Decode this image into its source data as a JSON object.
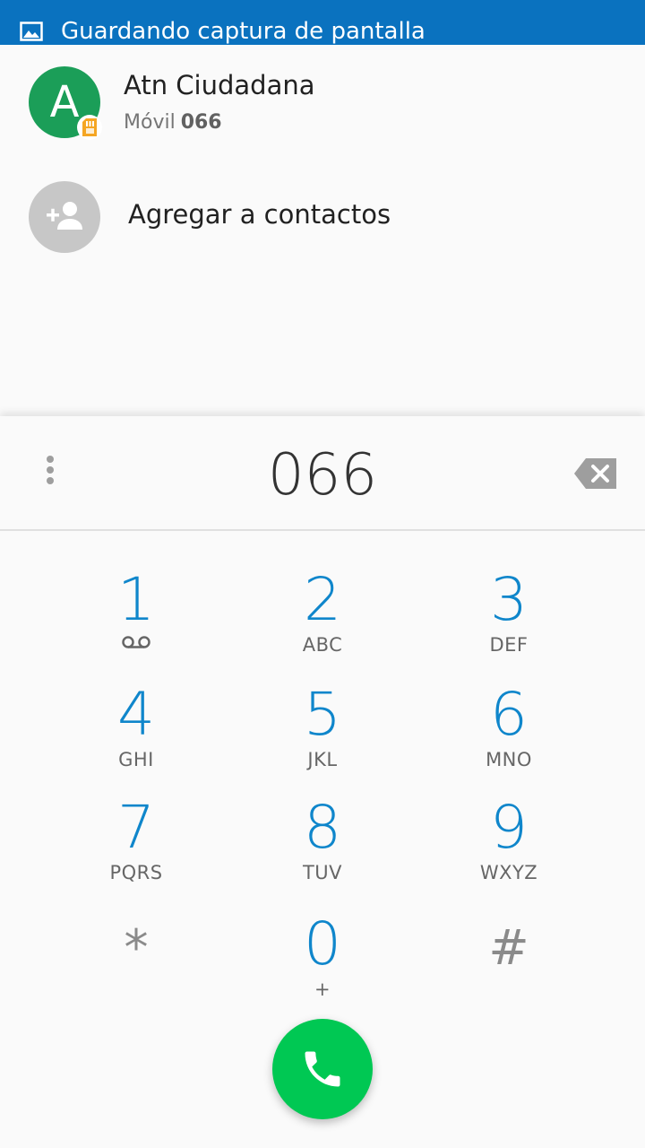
{
  "status_bar": {
    "icon": "screenshot-image-icon",
    "text": "Guardando captura de pantalla",
    "color": "#0a72bf"
  },
  "suggestions": {
    "contact": {
      "avatar_letter": "A",
      "avatar_color": "#1b9e58",
      "name": "Atn Ciudadana",
      "type_label": "Móvil",
      "number": "066",
      "badge_icon": "sim-card-icon"
    },
    "add_contact": {
      "icon": "add-person-icon",
      "label": "Agregar a contactos"
    }
  },
  "dialpad": {
    "entered_digits": "066",
    "keys": [
      {
        "digit": "1",
        "letters": "",
        "extra_icon": "voicemail-icon"
      },
      {
        "digit": "2",
        "letters": "ABC"
      },
      {
        "digit": "3",
        "letters": "DEF"
      },
      {
        "digit": "4",
        "letters": "GHI"
      },
      {
        "digit": "5",
        "letters": "JKL"
      },
      {
        "digit": "6",
        "letters": "MNO"
      },
      {
        "digit": "7",
        "letters": "PQRS"
      },
      {
        "digit": "8",
        "letters": "TUV"
      },
      {
        "digit": "9",
        "letters": "WXYZ"
      },
      {
        "digit": "*",
        "letters": ""
      },
      {
        "digit": "0",
        "letters": "+"
      },
      {
        "digit": "#",
        "letters": ""
      }
    ],
    "digit_color": "#0f86cb",
    "call_button_color": "#00c853",
    "call_icon": "phone-icon"
  }
}
